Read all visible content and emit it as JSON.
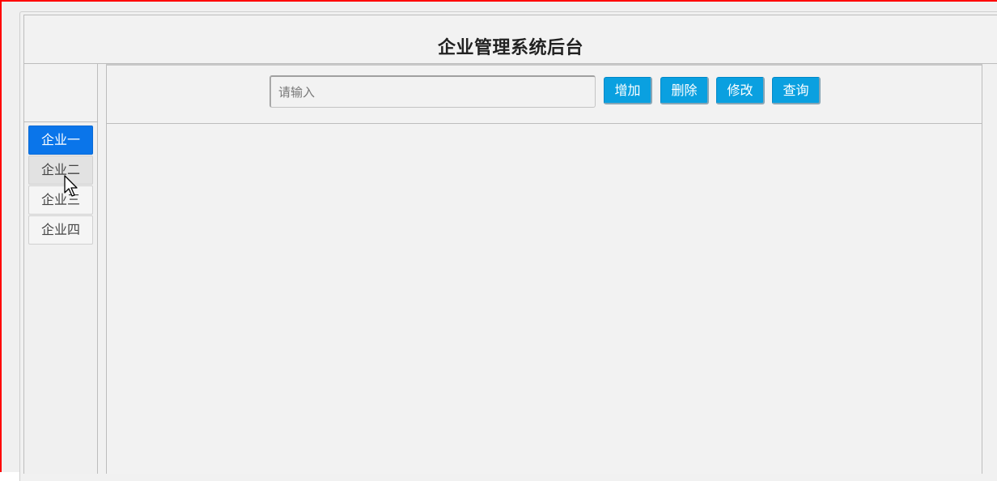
{
  "header": {
    "title": "企业管理系统后台"
  },
  "toolbar": {
    "search_placeholder": "请输入",
    "search_value": "",
    "add_label": "增加",
    "delete_label": "删除",
    "modify_label": "修改",
    "query_label": "查询"
  },
  "sidebar": {
    "items": [
      {
        "label": "企业一",
        "state": "active"
      },
      {
        "label": "企业二",
        "state": "hover"
      },
      {
        "label": "企业三",
        "state": "normal"
      },
      {
        "label": "企业四",
        "state": "normal"
      }
    ]
  },
  "colors": {
    "active_item": "#0a75ea",
    "button": "#0aa0e0",
    "window_border": "#ff0000"
  },
  "icons": {
    "cursor": "mouse-pointer-icon"
  }
}
